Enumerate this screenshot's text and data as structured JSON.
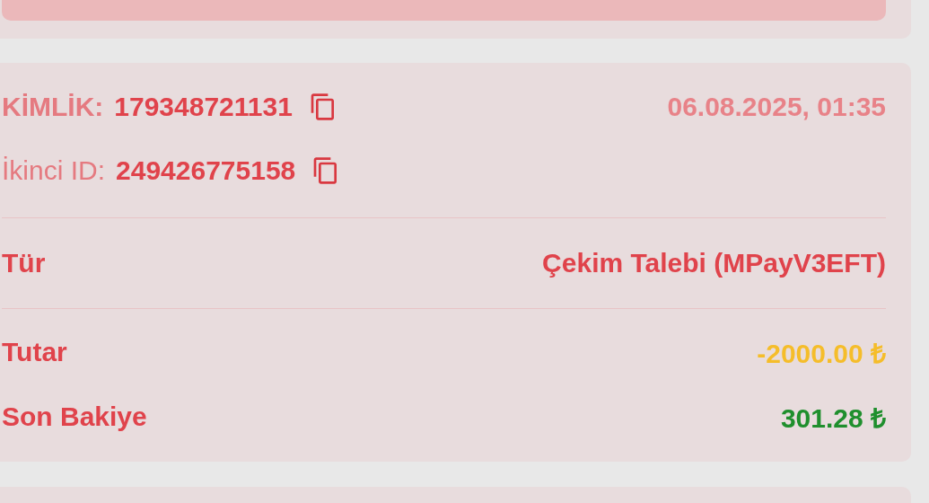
{
  "transaction": {
    "id_label": "KİMLİK:",
    "id": "179348721131",
    "date": "06.08.2025, 01:35",
    "second_id_label": "İkinci ID:",
    "second_id": "249426775158",
    "type_label": "Tür",
    "type": "Çekim Talebi (MPayV3EFT)",
    "amounts": [
      {
        "label": "Tutar",
        "value": "-2000.00 ₺",
        "color": "#f5bd2a"
      },
      {
        "label": "Son Bakiye",
        "value": "301.28 ₺",
        "color": "#1f8f2d"
      }
    ]
  }
}
